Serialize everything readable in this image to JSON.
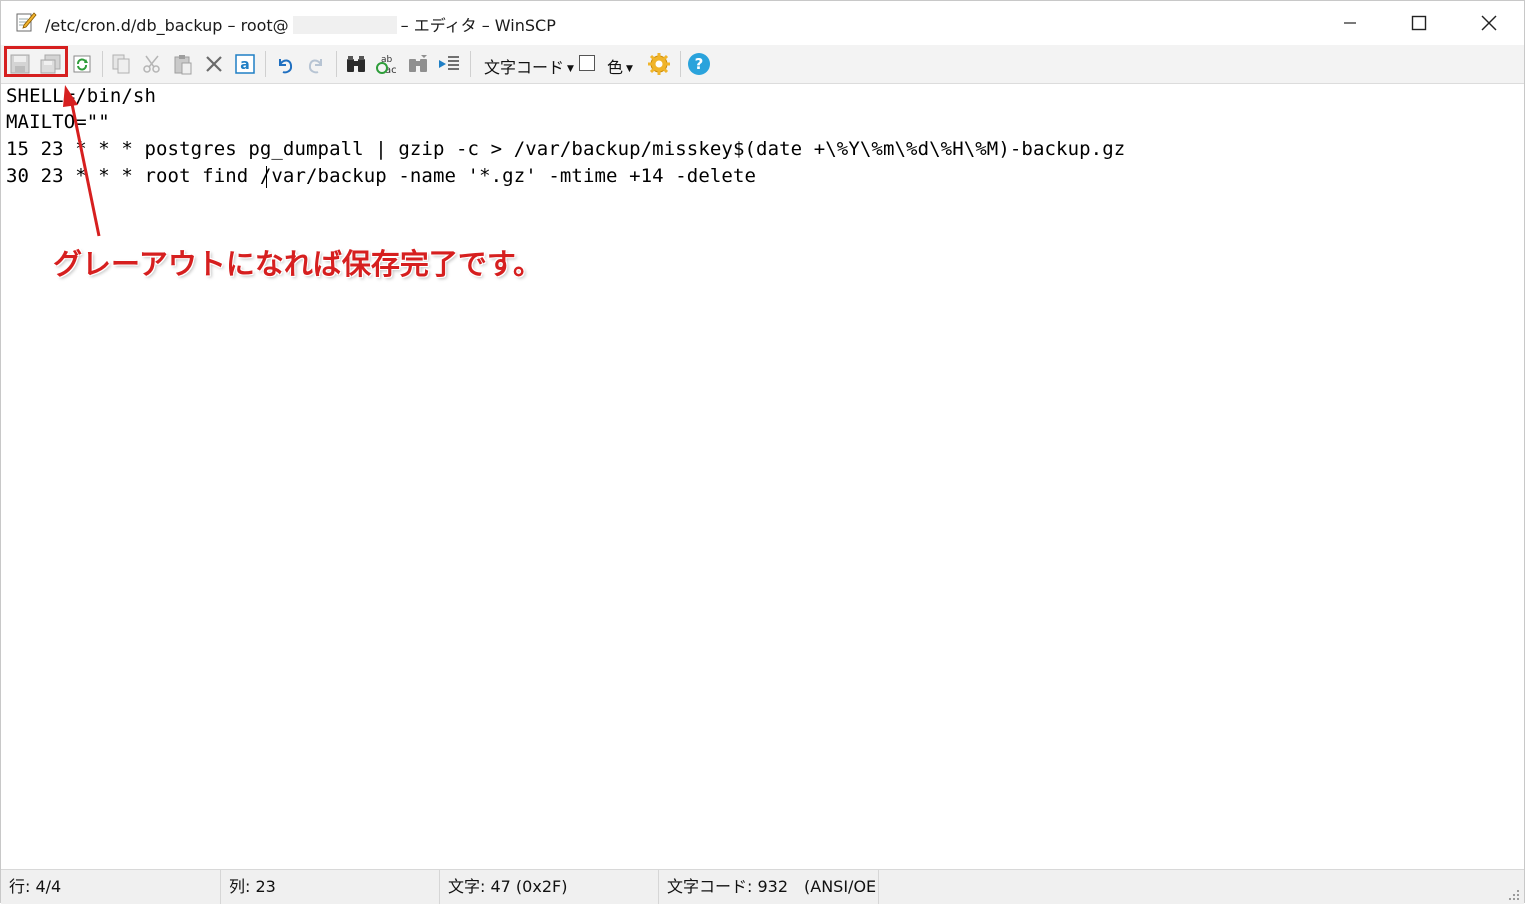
{
  "window": {
    "title_left": "/etc/cron.d/db_backup – root@",
    "title_right": "– エディタ – WinSCP"
  },
  "toolbar": {
    "encoding_label": "文字コード",
    "color_label": "色"
  },
  "editor": {
    "lines": [
      "SHELL=/bin/sh",
      "MAILTO=\"\"",
      "15 23 * * * postgres pg_dumpall | gzip -c > /var/backup/misskey$(date +\\%Y\\%m\\%d\\%H\\%M)-backup.gz",
      "30 23 * * * root find /var/backup -name '*.gz' -mtime +14 -delete"
    ]
  },
  "annotation": {
    "text": "グレーアウトになれば保存完了です。",
    "color": "#d61f1f"
  },
  "status": {
    "line": "行: 4/4",
    "column": "列: 23",
    "char": "文字: 47 (0x2F)",
    "encoding": "文字コード: 932　(ANSI/OE"
  }
}
